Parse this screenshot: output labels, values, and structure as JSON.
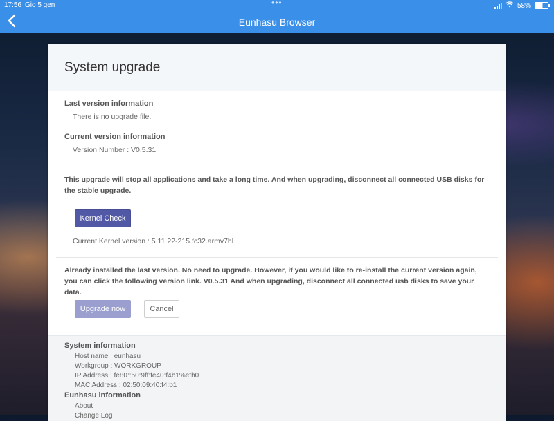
{
  "statusbar": {
    "time": "17:56",
    "date": "Gio 5 gen",
    "dots": "•••",
    "battery": "58%",
    "battery_level": 0.58
  },
  "navbar": {
    "title": "Eunhasu Browser",
    "back_icon": "chevron-left-icon"
  },
  "page": {
    "title": "System upgrade",
    "last_version": {
      "label": "Last version information",
      "value": "There is no upgrade file."
    },
    "current_version": {
      "label": "Current version information",
      "value": "Version Number : V0.5.31"
    },
    "kernel": {
      "warning": "This upgrade will stop all applications and take a long time. And when upgrading, disconnect all connected USB disks for the stable upgrade.",
      "button": "Kernel Check",
      "current": "Current Kernel version : 5.11.22-215.fc32.armv7hl"
    },
    "upgrade": {
      "note": "Already installed the last version. No need to upgrade. However, if you would like to re-install the current version again, you can click the following version link. V0.5.31 And when upgrading, disconnect all connected usb disks to save your data.",
      "upgrade_button": "Upgrade now",
      "cancel_button": "Cancel"
    }
  },
  "footer": {
    "system_label": "System information",
    "host": "Host name : eunhasu",
    "workgroup": "Workgroup : WORKGROUP",
    "ip": "IP Address : fe80::50:9ff:fe40:f4b1%eth0",
    "mac": "MAC Address : 02:50:09:40:f4:b1",
    "eunhasu_label": "Eunhasu information",
    "about": "About",
    "changelog": "Change Log"
  }
}
